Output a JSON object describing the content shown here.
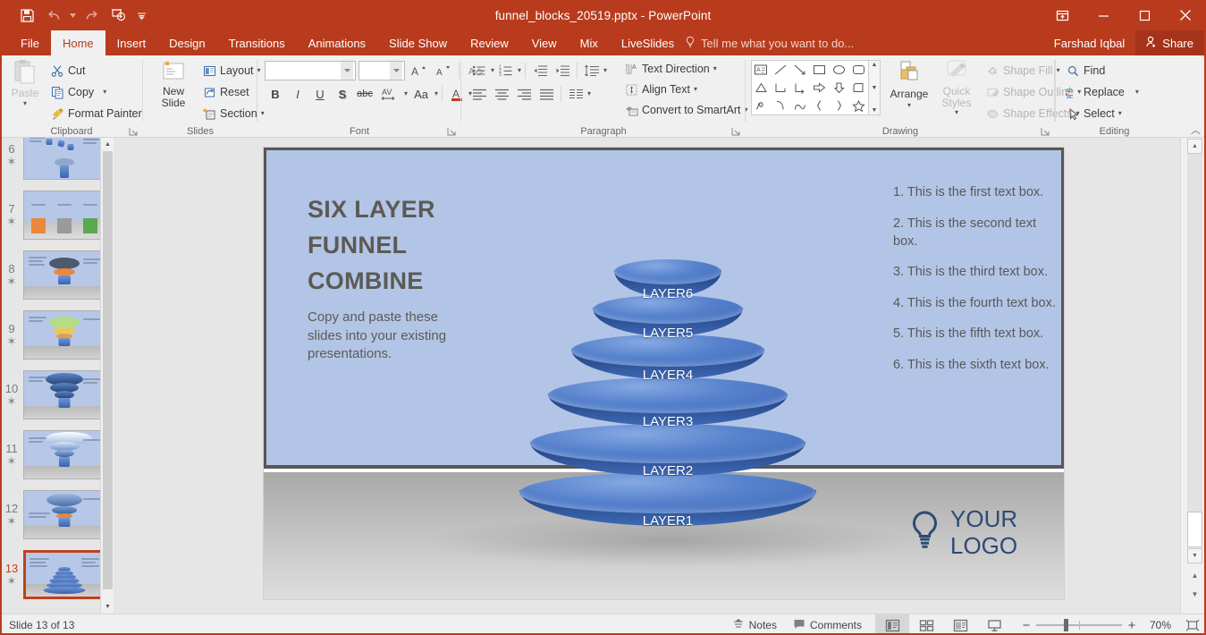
{
  "window": {
    "title": "funnel_blocks_20519.pptx - PowerPoint",
    "user": "Farshad Iqbal",
    "share_label": "Share",
    "accent_color": "#b83b1d",
    "quick_access": [
      {
        "name": "save-icon",
        "label": "Save"
      },
      {
        "name": "undo-icon",
        "label": "Undo"
      },
      {
        "name": "redo-icon",
        "label": "Redo"
      },
      {
        "name": "start-presentation-icon",
        "label": "Start From Beginning"
      },
      {
        "name": "customize-qat-icon",
        "label": "Customize Quick Access Toolbar"
      }
    ],
    "controls": [
      {
        "name": "ribbon-display-options-icon",
        "label": "Ribbon Display Options"
      },
      {
        "name": "minimize-icon",
        "label": "Minimize"
      },
      {
        "name": "maximize-icon",
        "label": "Maximize"
      },
      {
        "name": "close-icon",
        "label": "Close"
      }
    ]
  },
  "ribbon": {
    "tabs": [
      {
        "label": "File",
        "active": false
      },
      {
        "label": "Home",
        "active": true
      },
      {
        "label": "Insert",
        "active": false
      },
      {
        "label": "Design",
        "active": false
      },
      {
        "label": "Transitions",
        "active": false
      },
      {
        "label": "Animations",
        "active": false
      },
      {
        "label": "Slide Show",
        "active": false
      },
      {
        "label": "Review",
        "active": false
      },
      {
        "label": "View",
        "active": false
      },
      {
        "label": "Mix",
        "active": false
      },
      {
        "label": "LiveSlides",
        "active": false
      }
    ],
    "tell_me": "Tell me what you want to do...",
    "groups": {
      "clipboard": {
        "label": "Clipboard",
        "paste": "Paste",
        "items": [
          {
            "label": "Cut",
            "icon": "scissors-icon"
          },
          {
            "label": "Copy",
            "icon": "copy-icon"
          },
          {
            "label": "Format Painter",
            "icon": "format-painter-icon"
          }
        ]
      },
      "slides": {
        "label": "Slides",
        "new_slide": "New Slide",
        "items": [
          {
            "label": "Layout",
            "icon": "layout-icon"
          },
          {
            "label": "Reset",
            "icon": "reset-icon"
          },
          {
            "label": "Section",
            "icon": "section-icon"
          }
        ]
      },
      "font": {
        "label": "Font",
        "font_name": "",
        "font_name_placeholder": "",
        "font_size": "",
        "font_size_placeholder": "",
        "buttons": [
          {
            "label": "A",
            "name": "increase-font-size-button"
          },
          {
            "label": "A",
            "name": "decrease-font-size-button"
          },
          {
            "label": "",
            "name": "clear-formatting-button"
          },
          {
            "label": "B",
            "name": "bold-button"
          },
          {
            "label": "I",
            "name": "italic-button"
          },
          {
            "label": "U",
            "name": "underline-button"
          },
          {
            "label": "S",
            "name": "text-shadow-button"
          },
          {
            "label": "abc",
            "name": "strikethrough-button"
          },
          {
            "label": "AV",
            "name": "character-spacing-button"
          },
          {
            "label": "Aa",
            "name": "change-case-button"
          },
          {
            "label": "A",
            "name": "font-color-button"
          }
        ]
      },
      "paragraph": {
        "label": "Paragraph",
        "items": [
          {
            "label": "Text Direction",
            "icon": "text-direction-icon"
          },
          {
            "label": "Align Text",
            "icon": "align-text-icon"
          },
          {
            "label": "Convert to SmartArt",
            "icon": "smartart-icon"
          }
        ]
      },
      "drawing": {
        "label": "Drawing",
        "arrange": "Arrange",
        "quick_styles": "Quick Styles",
        "items": [
          {
            "label": "Shape Fill",
            "icon": "shape-fill-icon"
          },
          {
            "label": "Shape Outline",
            "icon": "shape-outline-icon"
          },
          {
            "label": "Shape Effects",
            "icon": "shape-effects-icon"
          }
        ]
      },
      "editing": {
        "label": "Editing",
        "items": [
          {
            "label": "Find",
            "icon": "search-icon"
          },
          {
            "label": "Replace",
            "icon": "replace-icon"
          },
          {
            "label": "Select",
            "icon": "select-pointer-icon"
          }
        ]
      }
    }
  },
  "thumbnails": {
    "selected": 13,
    "items": [
      {
        "number": "6",
        "starred": true
      },
      {
        "number": "7",
        "starred": true
      },
      {
        "number": "8",
        "starred": true
      },
      {
        "number": "9",
        "starred": true
      },
      {
        "number": "10",
        "starred": true
      },
      {
        "number": "11",
        "starred": true
      },
      {
        "number": "12",
        "starred": true
      },
      {
        "number": "13",
        "starred": true
      }
    ]
  },
  "slide": {
    "title_lines": [
      "SIX LAYER",
      "FUNNEL",
      "COMBINE"
    ],
    "subtitle": "Copy and paste these slides into your existing presentations.",
    "bullets": [
      "1. This is the first text box.",
      "2. This is the second text box.",
      "3. This is the third text box.",
      "4. This is the fourth text box.",
      "5. This is the fifth text box.",
      "6. This is the sixth text box."
    ],
    "logo_line1": "YOUR",
    "logo_line2": "LOGO",
    "funnel_layers": [
      {
        "label": "LAYER6"
      },
      {
        "label": "LAYER5"
      },
      {
        "label": "LAYER4"
      },
      {
        "label": "LAYER3"
      },
      {
        "label": "LAYER2"
      },
      {
        "label": "LAYER1"
      }
    ],
    "panel_color": "#b3c5e6",
    "title_color": "#5c5a55",
    "logo_color": "#2d4a75"
  },
  "statusbar": {
    "slide_counter": "Slide 13 of 13",
    "notes_label": "Notes",
    "comments_label": "Comments",
    "zoom_level": "70%",
    "views": [
      {
        "name": "normal-view-button",
        "active": true
      },
      {
        "name": "slide-sorter-view-button",
        "active": false
      },
      {
        "name": "reading-view-button",
        "active": false
      },
      {
        "name": "slideshow-view-button",
        "active": false
      }
    ],
    "fit_slide_label": "Fit slide to current window"
  }
}
